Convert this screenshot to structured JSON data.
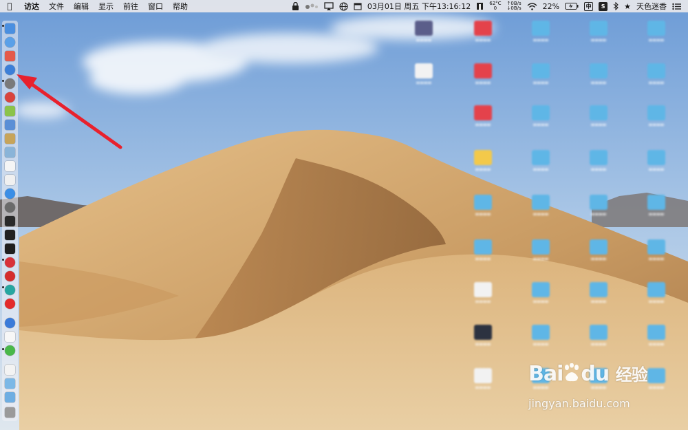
{
  "menubar": {
    "app_name": "访达",
    "menus": [
      "文件",
      "编辑",
      "显示",
      "前往",
      "窗口",
      "帮助"
    ],
    "datetime": "03月01日 周五 下午13:16:12",
    "cpu_temp": "62°C",
    "cpu_fan": "0",
    "net_up": "0B/s",
    "net_down": "0B/s",
    "battery": "22%",
    "input_method": "中",
    "user": "天色迷香"
  },
  "watermark": {
    "brand_a": "Bai",
    "brand_b": "du",
    "brand_c": "经验",
    "url": "jingyan.baidu.com"
  },
  "colors": {
    "arrow": "#e8212d",
    "folder": "#5fb6e6",
    "sky_top": "#6f9fd8",
    "sand": "#d8b27a"
  },
  "dock": {
    "icons": [
      "finder-icon",
      "safari-icon",
      "calendar-icon",
      "compass-icon",
      "launchpad-icon",
      "app-red-icon",
      "android-icon",
      "preview-icon",
      "notes-icon",
      "maps-icon",
      "textedit-icon",
      "pages-icon",
      "appstore-icon",
      "system-preferences-icon",
      "activity-monitor-icon",
      "terminal-icon",
      "terminal-2-icon",
      "vivaldi-icon",
      "netease-music-icon",
      "browser-green-icon",
      "yandex-icon",
      "baidu-netdisk-icon",
      "document-icon",
      "wechat-icon",
      "file-icon",
      "folder-icon",
      "downloads-folder-icon",
      "trash-icon"
    ]
  }
}
